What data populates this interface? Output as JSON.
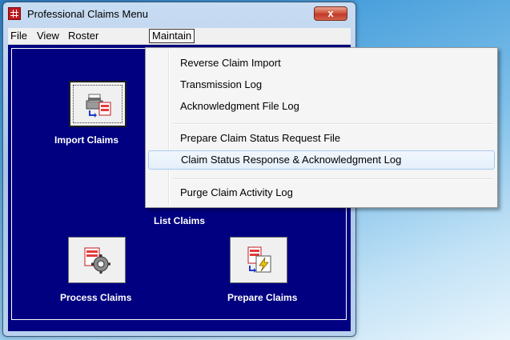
{
  "window": {
    "title": "Professional Claims Menu",
    "close_label": "x"
  },
  "menubar": {
    "items": [
      {
        "label": "File"
      },
      {
        "label": "View"
      },
      {
        "label": "Roster"
      },
      {
        "label": "Maintain"
      }
    ]
  },
  "tiles": {
    "import": {
      "label": "Import Claims",
      "icon": "printer-import-icon"
    },
    "list": {
      "label": "List Claims"
    },
    "process": {
      "label": "Process Claims",
      "icon": "gear-document-icon"
    },
    "prepare": {
      "label": "Prepare Claims",
      "icon": "document-lightning-icon"
    }
  },
  "maintain_menu": {
    "items": [
      {
        "label": "Reverse Claim Import"
      },
      {
        "label": "Transmission Log"
      },
      {
        "label": "Acknowledgment File Log"
      },
      {
        "label": "Prepare Claim Status Request File"
      },
      {
        "label": "Claim Status Response & Acknowledgment Log"
      },
      {
        "label": "Purge Claim Activity Log"
      }
    ]
  },
  "colors": {
    "client_background": "#000080",
    "menu_hover": "#e4effb",
    "close_button": "#c0392b"
  }
}
